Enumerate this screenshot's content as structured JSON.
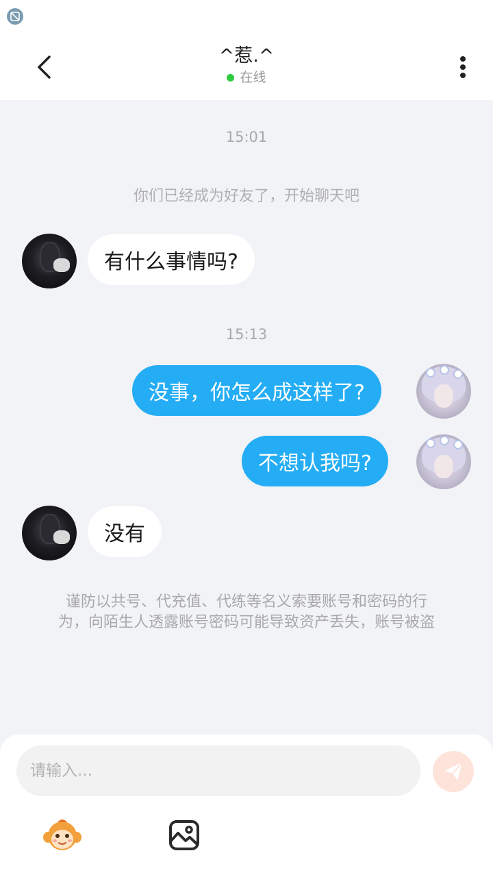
{
  "header": {
    "title": "^惹.^",
    "status": "在线"
  },
  "chat": {
    "time1": "15:01",
    "system_message": "你们已经成为好友了，开始聊天吧",
    "msg1": "有什么事情吗?",
    "time2": "15:13",
    "msg2": "没事，你怎么成这样了?",
    "msg3": "不想认我吗?",
    "msg4": "没有",
    "notice_line1": "谨防以共号、代充值、代练等名义索要账号和密码的行",
    "notice_line2": "为，向陌生人透露账号密码可能导致资产丢失，账号被盗"
  },
  "input": {
    "placeholder": "请输入..."
  },
  "colors": {
    "accent_blue": "#24adf5",
    "online_green": "#2ecc40",
    "send_button": "#fde3da"
  },
  "icons": [
    "back-arrow-icon",
    "more-vertical-icon",
    "send-icon",
    "emoji-icon",
    "image-icon"
  ]
}
